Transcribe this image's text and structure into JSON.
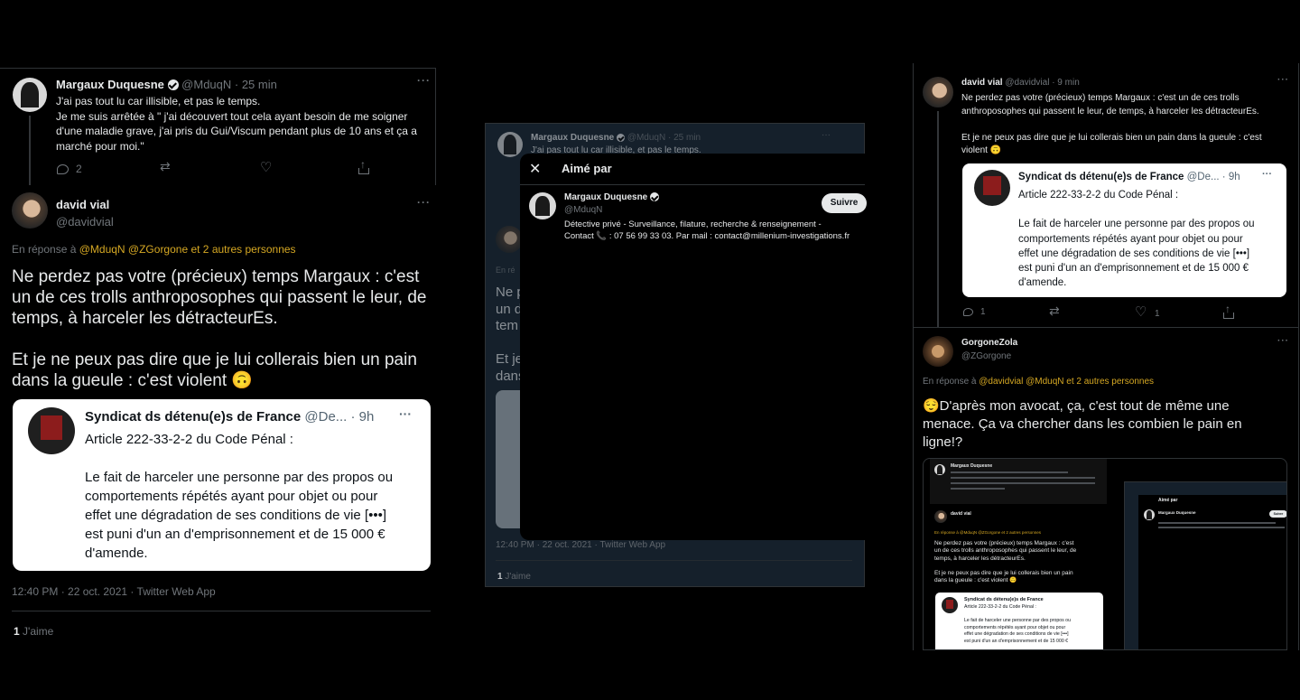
{
  "colors": {
    "background": "#000000",
    "text": "#e7e9ea",
    "secondary": "#71767b",
    "accent": "#d6a823",
    "card": "#ffffff"
  },
  "left": {
    "tweet1": {
      "name": "Margaux Duquesne",
      "handle": "@MduqN · 25 min",
      "text": [
        "J'ai pas tout lu car illisible, et pas le temps.",
        "Je me suis arrêtée à \" j'ai découvert tout cela ayant besoin de me soigner",
        "d'une maladie grave, j'ai pris du Gui/Viscum pendant plus de 10 ans et ça a",
        "marché pour moi.\""
      ],
      "reply_count": "2"
    },
    "tweet2": {
      "name": "david vial",
      "handle": "@davidvial",
      "reply_prefix": "En réponse à ",
      "reply_users": "@MduqN @ZGorgone  et 2 autres personnes",
      "text": [
        "Ne perdez pas votre (précieux) temps Margaux : c'est",
        "un de ces trolls anthroposophes qui passent le leur, de",
        "temps, à harceler les détracteurEs.",
        "",
        "Et je ne peux pas dire que je lui collerais bien un pain",
        "dans la gueule : c'est violent 🙃"
      ],
      "card": {
        "name": "Syndicat ds détenu(e)s de France",
        "handle": "@De...",
        "time": "· 9h",
        "text": [
          "Article 222-33-2-2 du Code Pénal :",
          "",
          "Le fait de harceler une personne par des propos ou",
          "comportements répétés ayant pour objet ou pour",
          "effet une dégradation de ses conditions de vie [•••]",
          "est puni d'un an d'emprisonnement et de 15 000 €",
          "d'amende."
        ]
      },
      "meta": "12:40 PM · 22 oct. 2021 · Twitter Web App",
      "likes_count": "1",
      "likes_label": " J'aime"
    }
  },
  "middle": {
    "bg_tweet": {
      "name": "Margaux Duquesne",
      "handle": "@MduqN · 25 min",
      "text": "J'ai pas tout lu car illisible, et pas le temps.",
      "reply_prefix": "En ré",
      "snippet": [
        "Ne p",
        "un d",
        "tem",
        "",
        "Et je",
        "dans"
      ],
      "meta": "12:40 PM · 22 oct. 2021 · Twitter Web App",
      "likes_count": "1",
      "likes_label": " J'aime"
    },
    "modal": {
      "title": "Aimé par",
      "user_name": "Margaux Duquesne",
      "user_handle": "@MduqN",
      "follow_label": "Suivre",
      "bio": [
        "Détective privé - Surveillance, filature, recherche & renseignement -",
        "Contact 📞 : 07 56 99 33 03. Par mail : contact@millenium-investigations.fr"
      ]
    }
  },
  "right": {
    "tweet1": {
      "name": "david vial",
      "handle": "@davidvial · 9 min",
      "text": [
        "Ne perdez pas votre (précieux) temps Margaux : c'est un de ces trolls",
        "anthroposophes qui passent le leur, de temps, à harceler les détracteurEs.",
        "",
        "Et je ne peux pas dire que je lui collerais bien un pain dans la gueule : c'est",
        "violent 🙃"
      ],
      "card": {
        "name": "Syndicat ds détenu(e)s de France",
        "handle": "@De...",
        "time": "· 9h",
        "text": [
          "Article 222-33-2-2 du Code Pénal :",
          "",
          "Le fait de harceler une personne par des propos ou",
          "comportements répétés ayant pour objet ou pour",
          "effet une dégradation de ses conditions de vie [•••]",
          "est puni d'un an d'emprisonnement et de 15 000 €",
          "d'amende."
        ]
      },
      "reply_count": "1",
      "like_count": "1"
    },
    "tweet2": {
      "name": "GorgoneZola",
      "handle": "@ZGorgone",
      "reply_prefix": "En réponse à ",
      "reply_users": "@davidvial @MduqN  et 2 autres personnes",
      "text": [
        "😌D'après mon avocat, ça, c'est tout de même une",
        "menace. Ça va chercher dans les combien le pain en",
        "ligne!?"
      ]
    },
    "mini_shot": {
      "name1": "Margaux Duquesne",
      "name2": "david vial",
      "reply": "En réponse à @MduqN @ZGorgone  et 2 autres personnes",
      "text": [
        "Ne perdez pas votre (précieux) temps Margaux : c'est",
        "un de ces trolls anthroposophes qui passent le leur, de",
        "temps, à harceler les détracteurEs.",
        "",
        "Et je ne peux pas dire que je lui collerais bien un pain",
        "dans la gueule : c'est violent 🙃"
      ],
      "card_name": "Syndicat ds détenu(e)s de France",
      "card_text": [
        "Article 222-33-2-2 du Code Pénal :",
        "",
        "Le fait de harceler une personne par des propos ou",
        "comportements répétés ayant pour objet ou pour",
        "effet une dégradation de ses conditions de vie [•••]",
        "est puni d'un an d'emprisonnement et de 15 000 €"
      ],
      "modal_title": "Aimé par",
      "modal_user": "Margaux Duquesne",
      "modal_follow": "Suivre"
    }
  }
}
